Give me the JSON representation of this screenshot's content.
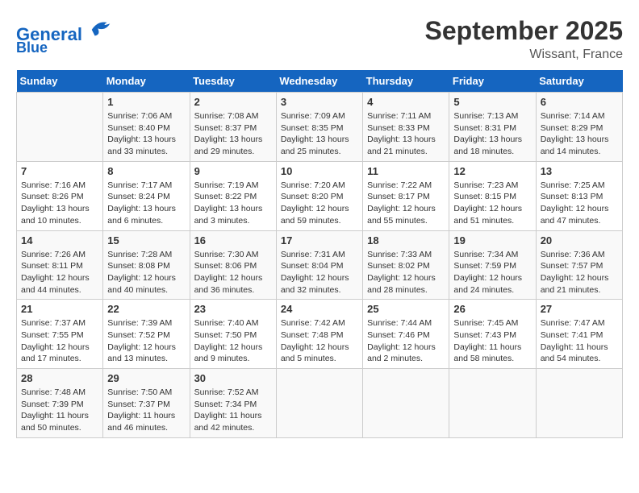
{
  "header": {
    "logo_line1": "General",
    "logo_line2": "Blue",
    "month": "September 2025",
    "location": "Wissant, France"
  },
  "weekdays": [
    "Sunday",
    "Monday",
    "Tuesday",
    "Wednesday",
    "Thursday",
    "Friday",
    "Saturday"
  ],
  "weeks": [
    [
      {
        "day": "",
        "text": ""
      },
      {
        "day": "1",
        "text": "Sunrise: 7:06 AM\nSunset: 8:40 PM\nDaylight: 13 hours\nand 33 minutes."
      },
      {
        "day": "2",
        "text": "Sunrise: 7:08 AM\nSunset: 8:37 PM\nDaylight: 13 hours\nand 29 minutes."
      },
      {
        "day": "3",
        "text": "Sunrise: 7:09 AM\nSunset: 8:35 PM\nDaylight: 13 hours\nand 25 minutes."
      },
      {
        "day": "4",
        "text": "Sunrise: 7:11 AM\nSunset: 8:33 PM\nDaylight: 13 hours\nand 21 minutes."
      },
      {
        "day": "5",
        "text": "Sunrise: 7:13 AM\nSunset: 8:31 PM\nDaylight: 13 hours\nand 18 minutes."
      },
      {
        "day": "6",
        "text": "Sunrise: 7:14 AM\nSunset: 8:29 PM\nDaylight: 13 hours\nand 14 minutes."
      }
    ],
    [
      {
        "day": "7",
        "text": "Sunrise: 7:16 AM\nSunset: 8:26 PM\nDaylight: 13 hours\nand 10 minutes."
      },
      {
        "day": "8",
        "text": "Sunrise: 7:17 AM\nSunset: 8:24 PM\nDaylight: 13 hours\nand 6 minutes."
      },
      {
        "day": "9",
        "text": "Sunrise: 7:19 AM\nSunset: 8:22 PM\nDaylight: 13 hours\nand 3 minutes."
      },
      {
        "day": "10",
        "text": "Sunrise: 7:20 AM\nSunset: 8:20 PM\nDaylight: 12 hours\nand 59 minutes."
      },
      {
        "day": "11",
        "text": "Sunrise: 7:22 AM\nSunset: 8:17 PM\nDaylight: 12 hours\nand 55 minutes."
      },
      {
        "day": "12",
        "text": "Sunrise: 7:23 AM\nSunset: 8:15 PM\nDaylight: 12 hours\nand 51 minutes."
      },
      {
        "day": "13",
        "text": "Sunrise: 7:25 AM\nSunset: 8:13 PM\nDaylight: 12 hours\nand 47 minutes."
      }
    ],
    [
      {
        "day": "14",
        "text": "Sunrise: 7:26 AM\nSunset: 8:11 PM\nDaylight: 12 hours\nand 44 minutes."
      },
      {
        "day": "15",
        "text": "Sunrise: 7:28 AM\nSunset: 8:08 PM\nDaylight: 12 hours\nand 40 minutes."
      },
      {
        "day": "16",
        "text": "Sunrise: 7:30 AM\nSunset: 8:06 PM\nDaylight: 12 hours\nand 36 minutes."
      },
      {
        "day": "17",
        "text": "Sunrise: 7:31 AM\nSunset: 8:04 PM\nDaylight: 12 hours\nand 32 minutes."
      },
      {
        "day": "18",
        "text": "Sunrise: 7:33 AM\nSunset: 8:02 PM\nDaylight: 12 hours\nand 28 minutes."
      },
      {
        "day": "19",
        "text": "Sunrise: 7:34 AM\nSunset: 7:59 PM\nDaylight: 12 hours\nand 24 minutes."
      },
      {
        "day": "20",
        "text": "Sunrise: 7:36 AM\nSunset: 7:57 PM\nDaylight: 12 hours\nand 21 minutes."
      }
    ],
    [
      {
        "day": "21",
        "text": "Sunrise: 7:37 AM\nSunset: 7:55 PM\nDaylight: 12 hours\nand 17 minutes."
      },
      {
        "day": "22",
        "text": "Sunrise: 7:39 AM\nSunset: 7:52 PM\nDaylight: 12 hours\nand 13 minutes."
      },
      {
        "day": "23",
        "text": "Sunrise: 7:40 AM\nSunset: 7:50 PM\nDaylight: 12 hours\nand 9 minutes."
      },
      {
        "day": "24",
        "text": "Sunrise: 7:42 AM\nSunset: 7:48 PM\nDaylight: 12 hours\nand 5 minutes."
      },
      {
        "day": "25",
        "text": "Sunrise: 7:44 AM\nSunset: 7:46 PM\nDaylight: 12 hours\nand 2 minutes."
      },
      {
        "day": "26",
        "text": "Sunrise: 7:45 AM\nSunset: 7:43 PM\nDaylight: 11 hours\nand 58 minutes."
      },
      {
        "day": "27",
        "text": "Sunrise: 7:47 AM\nSunset: 7:41 PM\nDaylight: 11 hours\nand 54 minutes."
      }
    ],
    [
      {
        "day": "28",
        "text": "Sunrise: 7:48 AM\nSunset: 7:39 PM\nDaylight: 11 hours\nand 50 minutes."
      },
      {
        "day": "29",
        "text": "Sunrise: 7:50 AM\nSunset: 7:37 PM\nDaylight: 11 hours\nand 46 minutes."
      },
      {
        "day": "30",
        "text": "Sunrise: 7:52 AM\nSunset: 7:34 PM\nDaylight: 11 hours\nand 42 minutes."
      },
      {
        "day": "",
        "text": ""
      },
      {
        "day": "",
        "text": ""
      },
      {
        "day": "",
        "text": ""
      },
      {
        "day": "",
        "text": ""
      }
    ]
  ]
}
